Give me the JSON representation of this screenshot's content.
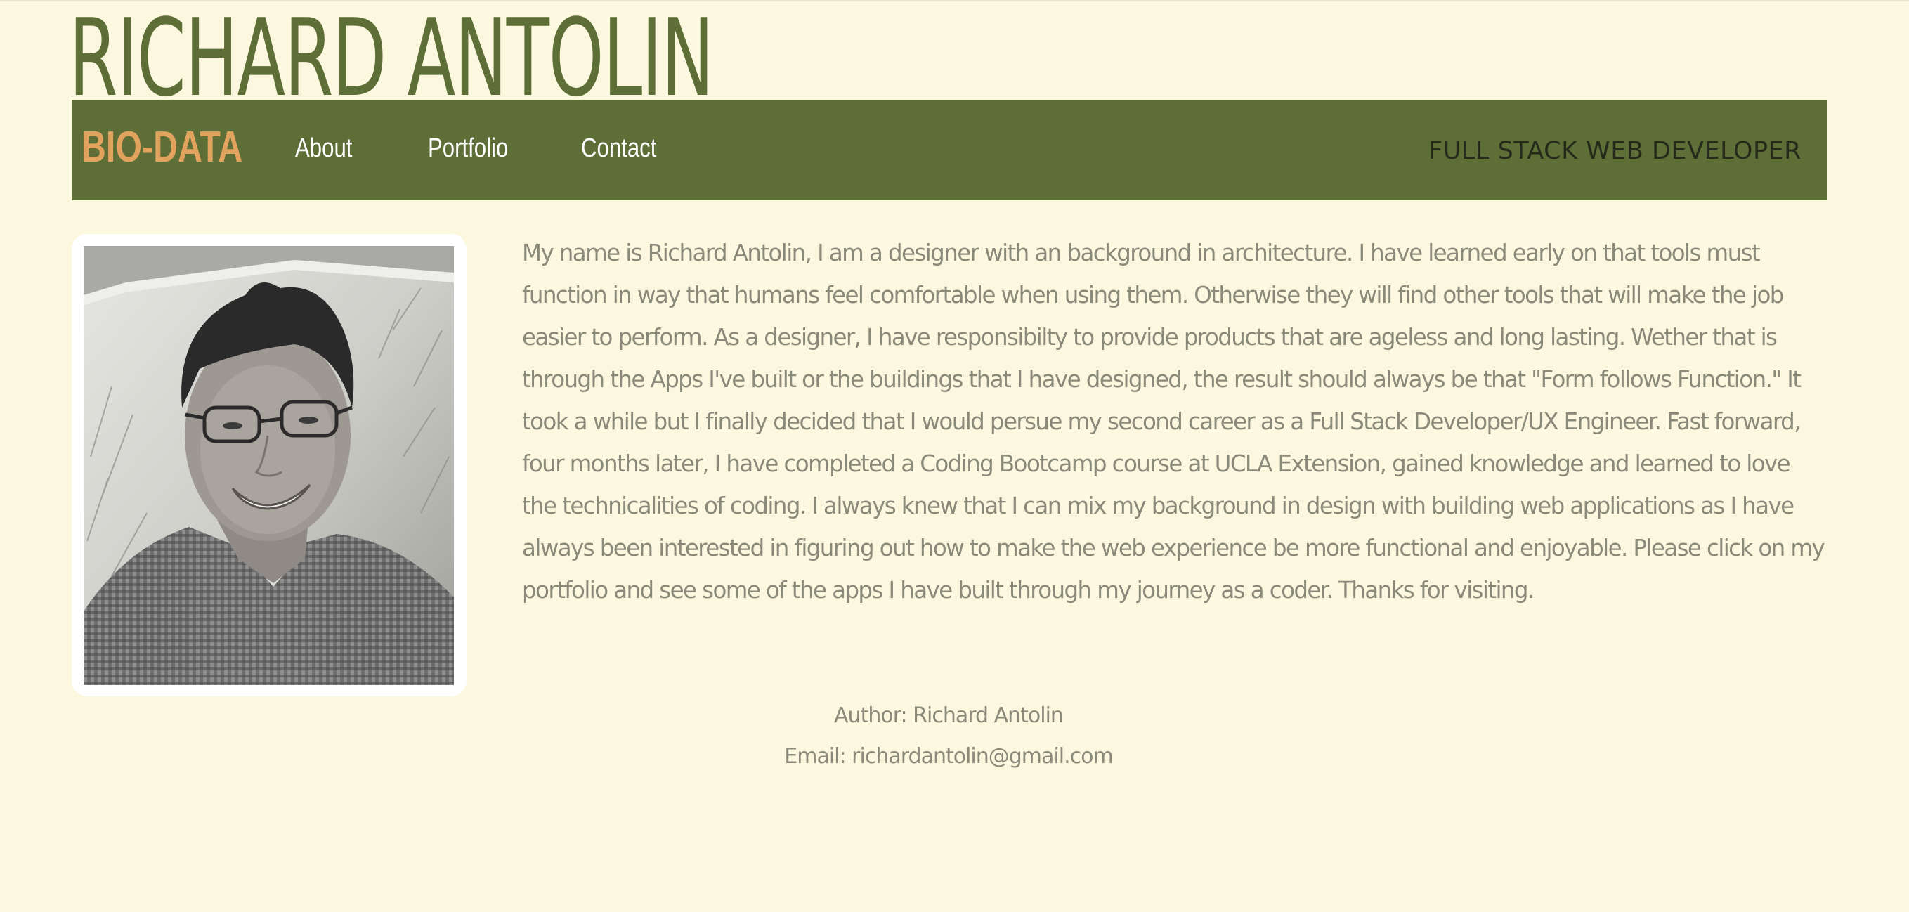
{
  "site": {
    "title": "RICHARD ANTOLIN"
  },
  "navbar": {
    "brand": "BIO-DATA",
    "links": [
      {
        "label": "About"
      },
      {
        "label": "Portfolio"
      },
      {
        "label": "Contact"
      }
    ],
    "tagline": "FULL STACK WEB DEVELOPER"
  },
  "main": {
    "bio": "My name is Richard Antolin, I am a designer with an background in architecture. I have learned early on that tools must function in way that humans feel comfortable when using them. Otherwise they will find other tools that will make the job easier to perform. As a designer, I have responsibilty to provide products that are ageless and long lasting. Wether that is through the Apps I've built or the buildings that I have designed, the result should always be that \"Form follows Function.\" It took a while but I finally decided that I would persue my second career as a Full Stack Developer/UX Engineer. Fast forward, four months later, I have completed a Coding Bootcamp course at UCLA Extension, gained knowledge and learned to love the technicalities of coding. I always knew that I can mix my background in design with building web applications as I have always been interested in figuring out how to make the web experience be more functional and enjoyable. Please click on my portfolio and see some of the apps I have built through my journey as a coder. Thanks for visiting."
  },
  "footer": {
    "author": "Author: Richard Antolin",
    "email": "Email: richardantolin@gmail.com"
  },
  "colors": {
    "background": "#fcf8df",
    "accent_green": "#5e6e37",
    "brand_orange": "#e2a35f",
    "body_text": "#8a8a7b"
  }
}
